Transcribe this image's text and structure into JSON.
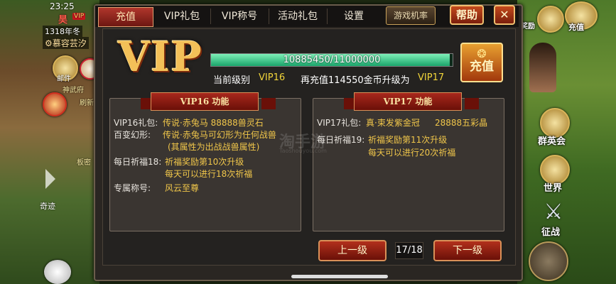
{
  "hud": {
    "time": "23:25",
    "title_char": "昊",
    "vip_badge": "VIP",
    "season": "1318年冬",
    "guild": "慕容芸汐",
    "mail": "邮件",
    "shenwu": "神武府",
    "refresh": "刷新",
    "zhanbu": "板密",
    "qiji": "奇迹"
  },
  "tabs": [
    {
      "label": "充值",
      "active": true
    },
    {
      "label": "VIP礼包",
      "active": false
    },
    {
      "label": "VIP称号",
      "active": false
    },
    {
      "label": "活动礼包",
      "active": false
    },
    {
      "label": "设置",
      "active": false
    }
  ],
  "top_buttons": {
    "probability": "游戏机率",
    "help": "帮助",
    "close": "✕"
  },
  "vip_logo": "VIP",
  "progress": {
    "text": "10885450/11000000",
    "current": 10885450,
    "max": 11000000
  },
  "level_line": {
    "current_label": "当前级别",
    "current_level": "VIP16",
    "recharge_text": "再充值114550金币升级为",
    "next_level": "VIP17"
  },
  "recharge_button": "充值",
  "vip16": {
    "ribbon": "VIP16  功能",
    "gift_label": "VIP16礼包:",
    "gift_value": "传说·赤兔马  88888兽灵石",
    "morph_label": "百变幻形:",
    "morph_value": "传说·赤兔马可幻形为任何战兽",
    "morph_note": "(其属性为出战战兽属性)",
    "bless_label": "每日祈福18:",
    "bless_value1": "祈福奖励第10次升级",
    "bless_value2": "每天可以进行18次祈福",
    "title_label": "专属称号:",
    "title_value": "风云至尊"
  },
  "vip17": {
    "ribbon": "VIP17  功能",
    "gift_label": "VIP17礼包:",
    "gift_value": "真·束发紫金冠",
    "gift_extra": "28888五彩晶",
    "bless_label": "每日祈福19:",
    "bless_value1": "祈福奖励第11次升级",
    "bless_value2": "每天可以进行20次祈福"
  },
  "nav": {
    "prev": "上一级",
    "page": "17/18",
    "next": "下一级"
  },
  "side_right": {
    "reward": "奖励",
    "charge": "充值",
    "heroes": "群英会",
    "world": "世界",
    "battle": "征战"
  },
  "watermark": {
    "text": "淘手游",
    "sub": "Taoshouyou.com"
  },
  "colors": {
    "highlight": "#f2d53a",
    "value_gold": "#f0c64a",
    "progress": "#1aa46a"
  }
}
